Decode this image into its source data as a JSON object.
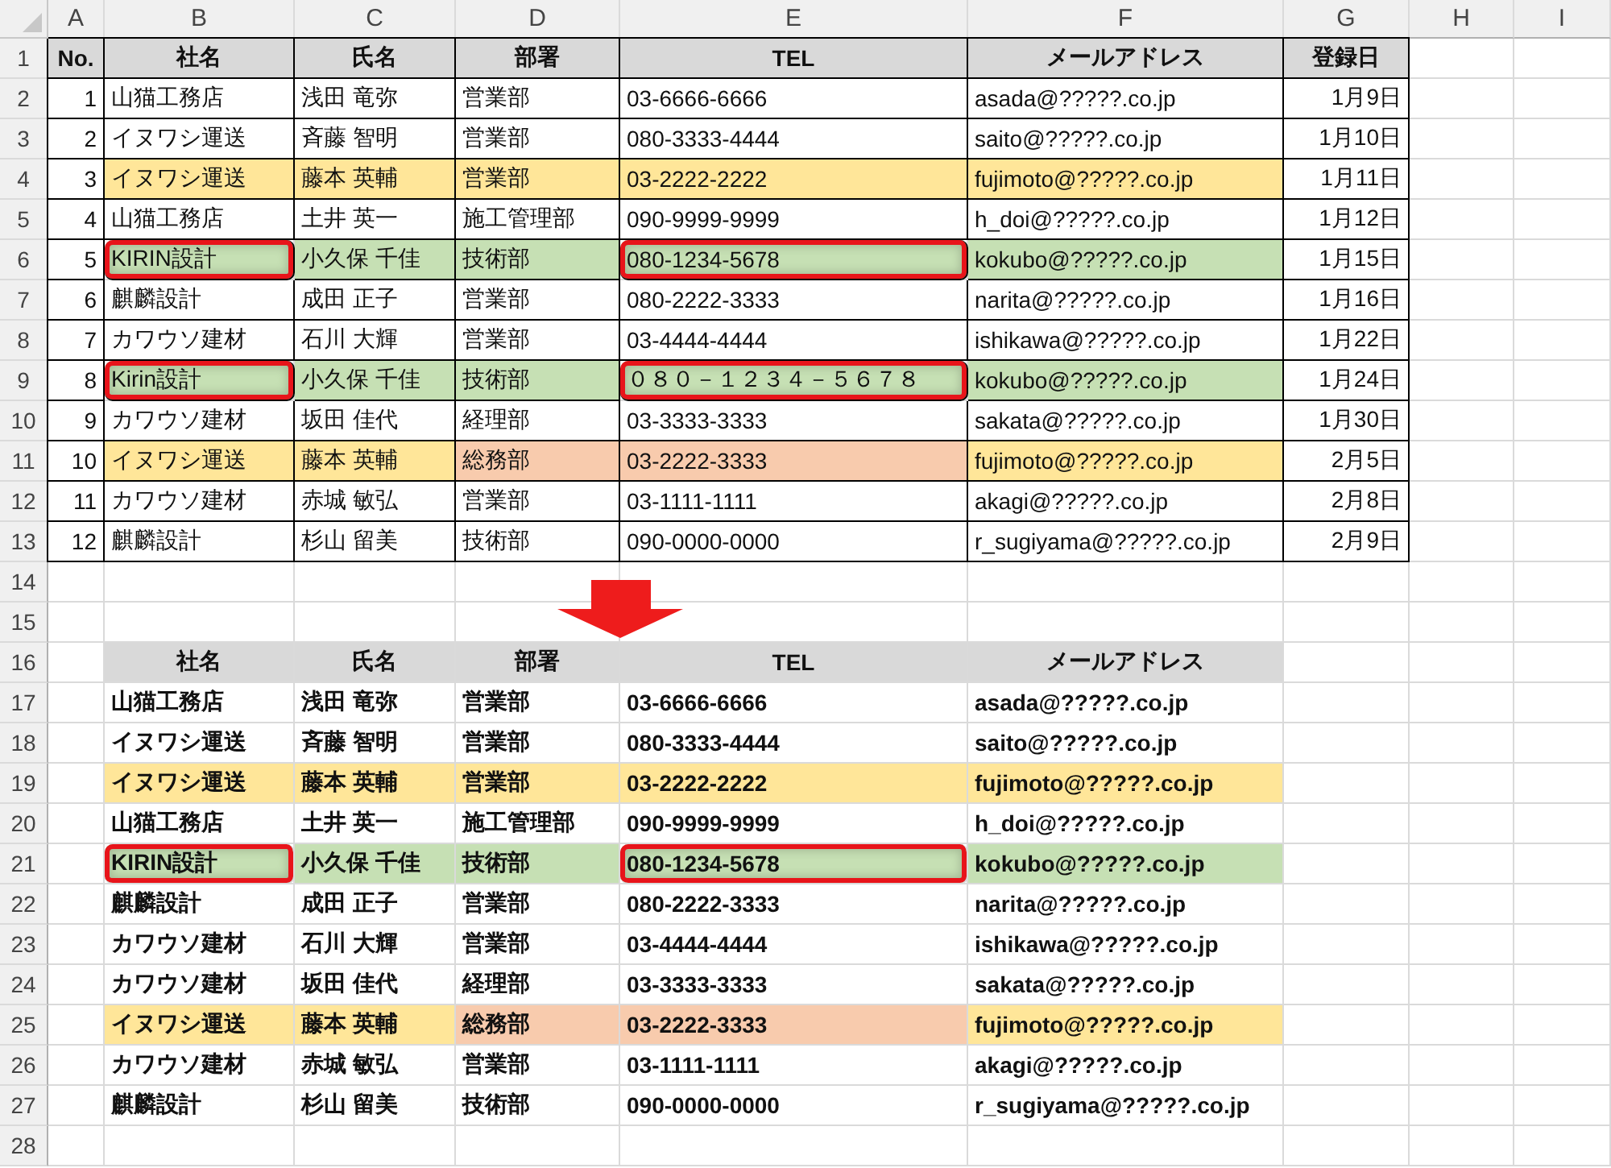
{
  "column_letters": [
    "A",
    "B",
    "C",
    "D",
    "E",
    "F",
    "G",
    "H",
    "I"
  ],
  "row_numbers": [
    "1",
    "2",
    "3",
    "4",
    "5",
    "6",
    "7",
    "8",
    "9",
    "10",
    "11",
    "12",
    "13",
    "14",
    "15",
    "16",
    "17",
    "18",
    "19",
    "20",
    "21",
    "22",
    "23",
    "24",
    "25",
    "26",
    "27",
    "28"
  ],
  "source_table": {
    "headers": [
      "No.",
      "社名",
      "氏名",
      "部署",
      "TEL",
      "メールアドレス",
      "登録日"
    ],
    "rows": [
      {
        "cells": [
          {
            "text": "1"
          },
          {
            "text": "山猫工務店"
          },
          {
            "text": "浅田 竜弥"
          },
          {
            "text": "営業部"
          },
          {
            "text": "03-6666-6666"
          },
          {
            "text": "asada@?????.co.jp"
          },
          {
            "text": "1月9日"
          }
        ]
      },
      {
        "cells": [
          {
            "text": "2"
          },
          {
            "text": "イヌワシ運送"
          },
          {
            "text": "斉藤 智明"
          },
          {
            "text": "営業部"
          },
          {
            "text": "080-3333-4444"
          },
          {
            "text": "saito@?????.co.jp"
          },
          {
            "text": "1月10日"
          }
        ]
      },
      {
        "cells": [
          {
            "text": "3"
          },
          {
            "text": "イヌワシ運送",
            "color": "#ffe699"
          },
          {
            "text": "藤本 英輔",
            "color": "#ffe699"
          },
          {
            "text": "営業部",
            "color": "#ffe699"
          },
          {
            "text": "03-2222-2222",
            "color": "#ffe699"
          },
          {
            "text": "fujimoto@?????.co.jp",
            "color": "#ffe699"
          },
          {
            "text": "1月11日"
          }
        ]
      },
      {
        "cells": [
          {
            "text": "4"
          },
          {
            "text": "山猫工務店"
          },
          {
            "text": "土井 英一"
          },
          {
            "text": "施工管理部"
          },
          {
            "text": "090-9999-9999"
          },
          {
            "text": "h_doi@?????.co.jp"
          },
          {
            "text": "1月12日"
          }
        ]
      },
      {
        "cells": [
          {
            "text": "5"
          },
          {
            "text": "KIRIN設計",
            "color": "#c6e0b4",
            "marked": true
          },
          {
            "text": "小久保 千佳",
            "color": "#c6e0b4"
          },
          {
            "text": "技術部",
            "color": "#c6e0b4"
          },
          {
            "text": "080-1234-5678",
            "color": "#c6e0b4",
            "marked": true
          },
          {
            "text": "kokubo@?????.co.jp",
            "color": "#c6e0b4"
          },
          {
            "text": "1月15日"
          }
        ]
      },
      {
        "cells": [
          {
            "text": "6"
          },
          {
            "text": "麒麟設計"
          },
          {
            "text": "成田 正子"
          },
          {
            "text": "営業部"
          },
          {
            "text": "080-2222-3333"
          },
          {
            "text": "narita@?????.co.jp"
          },
          {
            "text": "1月16日"
          }
        ]
      },
      {
        "cells": [
          {
            "text": "7"
          },
          {
            "text": "カワウソ建材"
          },
          {
            "text": "石川 大輝"
          },
          {
            "text": "営業部"
          },
          {
            "text": "03-4444-4444"
          },
          {
            "text": "ishikawa@?????.co.jp"
          },
          {
            "text": "1月22日"
          }
        ]
      },
      {
        "cells": [
          {
            "text": "8"
          },
          {
            "text": "Kirin設計",
            "color": "#c6e0b4",
            "marked": true
          },
          {
            "text": "小久保 千佳",
            "color": "#c6e0b4"
          },
          {
            "text": "技術部",
            "color": "#c6e0b4"
          },
          {
            "text": "０８０－１２３４－５６７８",
            "color": "#c6e0b4",
            "marked": true
          },
          {
            "text": "kokubo@?????.co.jp",
            "color": "#c6e0b4"
          },
          {
            "text": "1月24日"
          }
        ]
      },
      {
        "cells": [
          {
            "text": "9"
          },
          {
            "text": "カワウソ建材"
          },
          {
            "text": "坂田 佳代"
          },
          {
            "text": "経理部"
          },
          {
            "text": "03-3333-3333"
          },
          {
            "text": "sakata@?????.co.jp"
          },
          {
            "text": "1月30日"
          }
        ]
      },
      {
        "cells": [
          {
            "text": "10"
          },
          {
            "text": "イヌワシ運送",
            "color": "#ffe699"
          },
          {
            "text": "藤本 英輔",
            "color": "#ffe699"
          },
          {
            "text": "総務部",
            "color": "#f8cbad"
          },
          {
            "text": "03-2222-3333",
            "color": "#f8cbad"
          },
          {
            "text": "fujimoto@?????.co.jp",
            "color": "#ffe699"
          },
          {
            "text": "2月5日"
          }
        ]
      },
      {
        "cells": [
          {
            "text": "11"
          },
          {
            "text": "カワウソ建材"
          },
          {
            "text": "赤城 敏弘"
          },
          {
            "text": "営業部"
          },
          {
            "text": "03-1111-1111"
          },
          {
            "text": "akagi@?????.co.jp"
          },
          {
            "text": "2月8日"
          }
        ]
      },
      {
        "cells": [
          {
            "text": "12"
          },
          {
            "text": "麒麟設計"
          },
          {
            "text": "杉山 留美"
          },
          {
            "text": "技術部"
          },
          {
            "text": "090-0000-0000"
          },
          {
            "text": "r_sugiyama@?????.co.jp"
          },
          {
            "text": "2月9日"
          }
        ]
      }
    ]
  },
  "result_table": {
    "headers": [
      "社名",
      "氏名",
      "部署",
      "TEL",
      "メールアドレス"
    ],
    "rows": [
      {
        "cells": [
          {
            "text": "山猫工務店"
          },
          {
            "text": "浅田 竜弥"
          },
          {
            "text": "営業部"
          },
          {
            "text": "03-6666-6666"
          },
          {
            "text": "asada@?????.co.jp"
          }
        ]
      },
      {
        "cells": [
          {
            "text": "イヌワシ運送"
          },
          {
            "text": "斉藤 智明"
          },
          {
            "text": "営業部"
          },
          {
            "text": "080-3333-4444"
          },
          {
            "text": "saito@?????.co.jp"
          }
        ]
      },
      {
        "cells": [
          {
            "text": "イヌワシ運送",
            "color": "#ffe699"
          },
          {
            "text": "藤本 英輔",
            "color": "#ffe699"
          },
          {
            "text": "営業部",
            "color": "#ffe699"
          },
          {
            "text": "03-2222-2222",
            "color": "#ffe699"
          },
          {
            "text": "fujimoto@?????.co.jp",
            "color": "#ffe699"
          }
        ]
      },
      {
        "cells": [
          {
            "text": "山猫工務店"
          },
          {
            "text": "土井 英一"
          },
          {
            "text": "施工管理部"
          },
          {
            "text": "090-9999-9999"
          },
          {
            "text": "h_doi@?????.co.jp"
          }
        ]
      },
      {
        "cells": [
          {
            "text": "KIRIN設計",
            "color": "#c6e0b4",
            "marked": true
          },
          {
            "text": "小久保 千佳",
            "color": "#c6e0b4"
          },
          {
            "text": "技術部",
            "color": "#c6e0b4"
          },
          {
            "text": "080-1234-5678",
            "color": "#c6e0b4",
            "marked": true
          },
          {
            "text": "kokubo@?????.co.jp",
            "color": "#c6e0b4"
          }
        ]
      },
      {
        "cells": [
          {
            "text": "麒麟設計"
          },
          {
            "text": "成田 正子"
          },
          {
            "text": "営業部"
          },
          {
            "text": "080-2222-3333"
          },
          {
            "text": "narita@?????.co.jp"
          }
        ]
      },
      {
        "cells": [
          {
            "text": "カワウソ建材"
          },
          {
            "text": "石川 大輝"
          },
          {
            "text": "営業部"
          },
          {
            "text": "03-4444-4444"
          },
          {
            "text": "ishikawa@?????.co.jp"
          }
        ]
      },
      {
        "cells": [
          {
            "text": "カワウソ建材"
          },
          {
            "text": "坂田 佳代"
          },
          {
            "text": "経理部"
          },
          {
            "text": "03-3333-3333"
          },
          {
            "text": "sakata@?????.co.jp"
          }
        ]
      },
      {
        "cells": [
          {
            "text": "イヌワシ運送",
            "color": "#ffe699"
          },
          {
            "text": "藤本 英輔",
            "color": "#ffe699"
          },
          {
            "text": "総務部",
            "color": "#f8cbad"
          },
          {
            "text": "03-2222-3333",
            "color": "#f8cbad"
          },
          {
            "text": "fujimoto@?????.co.jp",
            "color": "#ffe699"
          }
        ]
      },
      {
        "cells": [
          {
            "text": "カワウソ建材"
          },
          {
            "text": "赤城 敏弘"
          },
          {
            "text": "営業部"
          },
          {
            "text": "03-1111-1111"
          },
          {
            "text": "akagi@?????.co.jp"
          }
        ]
      },
      {
        "cells": [
          {
            "text": "麒麟設計"
          },
          {
            "text": "杉山 留美"
          },
          {
            "text": "技術部"
          },
          {
            "text": "090-0000-0000"
          },
          {
            "text": "r_sugiyama@?????.co.jp"
          }
        ]
      }
    ]
  }
}
